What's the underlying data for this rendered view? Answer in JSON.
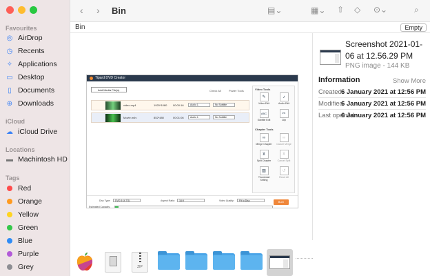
{
  "window": {
    "title": "Bin"
  },
  "toolbar": {
    "back_icon": "chevron-left-icon",
    "forward_icon": "chevron-right-icon",
    "view_icon": "view-options-icon",
    "group_icon": "grid-icon",
    "share_icon": "share-icon",
    "tag_icon": "tag-icon",
    "more_icon": "ellipsis-icon",
    "search_icon": "search-icon"
  },
  "pathbar": {
    "label": "Bin",
    "empty_button": "Empty"
  },
  "sidebar": {
    "favourites_header": "Favourites",
    "favourites": [
      {
        "label": "AirDrop",
        "icon": "airdrop-icon"
      },
      {
        "label": "Recents",
        "icon": "clock-icon"
      },
      {
        "label": "Applications",
        "icon": "applications-icon"
      },
      {
        "label": "Desktop",
        "icon": "desktop-icon"
      },
      {
        "label": "Documents",
        "icon": "document-icon"
      },
      {
        "label": "Downloads",
        "icon": "download-icon"
      }
    ],
    "icloud_header": "iCloud",
    "icloud": [
      {
        "label": "iCloud Drive",
        "icon": "cloud-icon"
      }
    ],
    "locations_header": "Locations",
    "locations": [
      {
        "label": "Machintosh HD",
        "icon": "disk-icon"
      }
    ],
    "tags_header": "Tags",
    "tags": [
      {
        "label": "Red",
        "color": "#ff4b4b"
      },
      {
        "label": "Orange",
        "color": "#ff9a1f"
      },
      {
        "label": "Yellow",
        "color": "#ffd41f"
      },
      {
        "label": "Green",
        "color": "#34c749"
      },
      {
        "label": "Blue",
        "color": "#2f8cf6"
      },
      {
        "label": "Purple",
        "color": "#b35bd8"
      },
      {
        "label": "Grey",
        "color": "#8e8e93"
      }
    ]
  },
  "app_preview": {
    "title": "Tipard DVD Creator",
    "add_button": "Add Media File(s)",
    "check_all": "Check All",
    "remove_tools": "Power Tools",
    "rows": [
      {
        "name": "video.mp4",
        "res": "1920*1080",
        "duration": "00:00:16",
        "audio": "Audio 1",
        "subtitle": "No Subtitle"
      },
      {
        "name": "Movie.m4v",
        "res": "852*480",
        "duration": "00:01:06",
        "audio": "Audio 1",
        "subtitle": "No Subtitle"
      }
    ],
    "video_tools_header": "Video Tools",
    "video_tools": [
      "Video Edit",
      "Audio Edit",
      "Subtitle Edit",
      "Clip"
    ],
    "chapter_tools_header": "Chapter Tools",
    "chapter_tools": [
      "Merge Chapter",
      "Cancel Merge",
      "Split Chapter",
      "Cancel Split",
      "Thumbnail Setting",
      "Reset All"
    ],
    "disc_type_label": "Disc Type:",
    "disc_type_value": "DVD-5 (4.7G)",
    "aspect_label": "Aspect Ratio:",
    "aspect_value": "16:9",
    "quality_label": "Video Quality:",
    "quality_value": "Fit to Disc",
    "capacity_label": "Estimated Capacity:",
    "burn_button": "Burn",
    "capacity_fraction": 0.02
  },
  "strip": {
    "doc_labels": [
      "",
      "ZIP"
    ]
  },
  "info": {
    "file_name": "Screenshot 2021-01-06 at 12.56.29 PM",
    "kind": "PNG image - 144 KB",
    "header": "Information",
    "show_more": "Show More",
    "rows": [
      {
        "key": "Created",
        "value": "6 January 2021 at 12:56 PM"
      },
      {
        "key": "Modified",
        "value": "6 January 2021 at 12:56 PM"
      },
      {
        "key": "Last opened",
        "value": "6 January 2021 at 12:56 PM"
      }
    ]
  }
}
